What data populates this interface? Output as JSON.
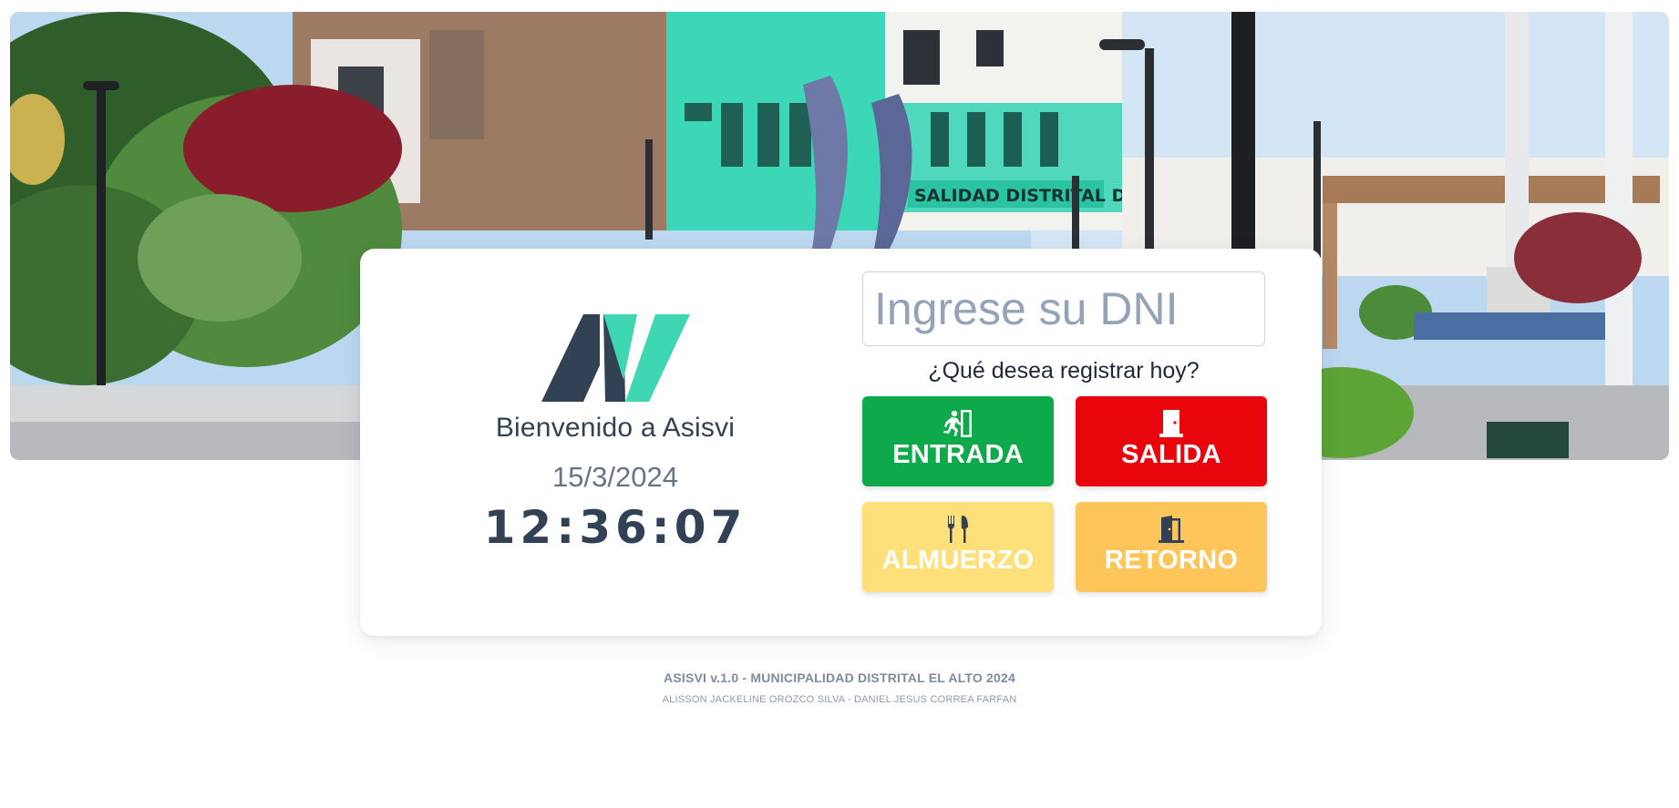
{
  "card": {
    "welcome": "Bienvenido a Asisvi",
    "date": "15/3/2024",
    "time": "12:36:07"
  },
  "form": {
    "dni_placeholder": "Ingrese su DNI",
    "dni_value": "",
    "question": "¿Qué desea registrar hoy?"
  },
  "actions": {
    "entrada": {
      "label": "ENTRADA",
      "icon": "person-running-exit-icon",
      "color": "#0ea94a"
    },
    "salida": {
      "label": "SALIDA",
      "icon": "door-icon",
      "color": "#e8050c"
    },
    "almuerzo": {
      "label": "ALMUERZO",
      "icon": "utensils-icon",
      "color": "#fde07a"
    },
    "retorno": {
      "label": "RETORNO",
      "icon": "door-open-icon",
      "color": "#fec55a"
    }
  },
  "hero": {
    "sign_text": "SALIDAD DISTRITAL DE EL ALTO"
  },
  "footer": {
    "line1": "ASISVI v.1.0 - MUNICIPALIDAD DISTRITAL EL ALTO 2024",
    "line2": "ALISSON JACKELINE OROZCO SILVA - DANIEL JESUS CORREA FARFAN"
  }
}
